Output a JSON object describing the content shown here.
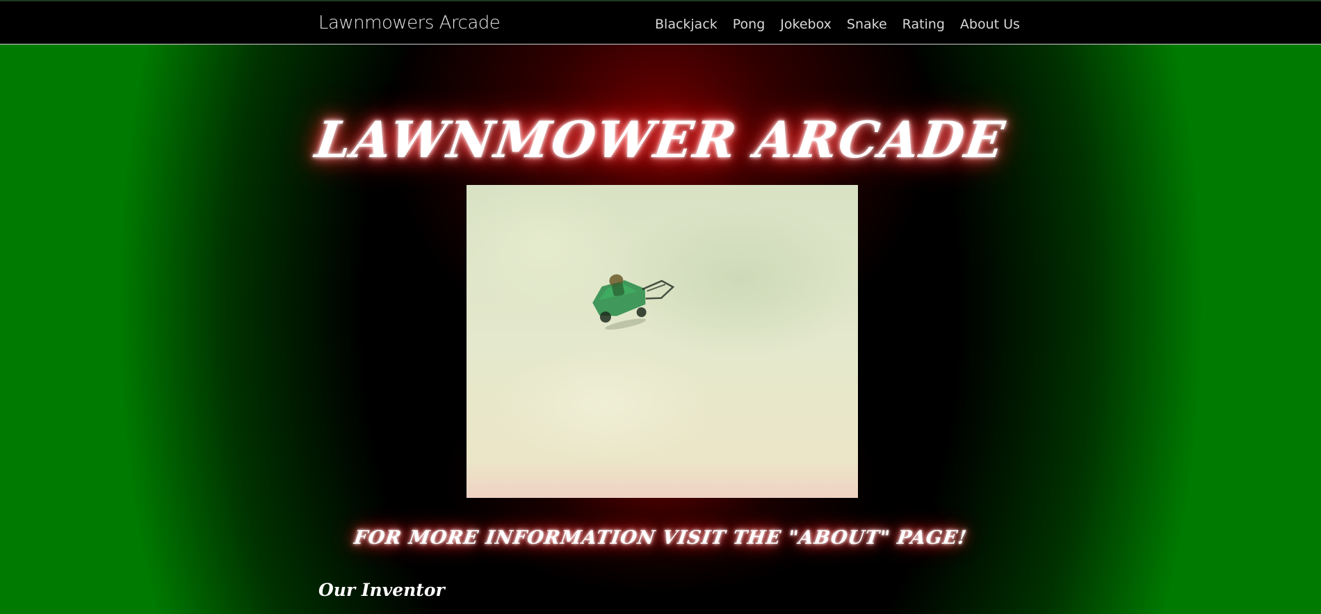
{
  "navbar": {
    "brand": "Lawnmowers Arcade",
    "links": [
      {
        "label": "Blackjack"
      },
      {
        "label": "Pong"
      },
      {
        "label": "Jokebox"
      },
      {
        "label": "Snake"
      },
      {
        "label": "Rating"
      },
      {
        "label": "About Us"
      }
    ]
  },
  "hero": {
    "title": "LAWNMOWER ARCADE",
    "image_subject": "flying-lawnmower-gif",
    "info": "FOR MORE INFORMATION VISIT THE \"ABOUT\" PAGE!"
  },
  "sections": {
    "inventor_title": "Our Inventor"
  },
  "colors": {
    "glow": "#ff0000",
    "side_green": "#007a00",
    "navbar_bg": "#000000"
  }
}
